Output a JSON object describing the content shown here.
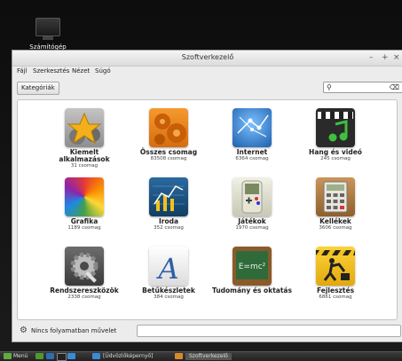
{
  "desktop": {
    "icon_label": "Számítógép"
  },
  "window": {
    "title": "Szoftverkezelő",
    "controls": {
      "minimize": "–",
      "maximize": "+",
      "close": "×"
    }
  },
  "menu": [
    "Fájl",
    "Szerkesztés",
    "Nézet",
    "Súgó"
  ],
  "toolbar": {
    "categories_label": "Kategóriák",
    "search_value": ""
  },
  "categories": [
    {
      "name": "Kiemelt alkalmazások",
      "count": "31 csomag",
      "icon": "star-gears-icon",
      "color": "#9a9a9a"
    },
    {
      "name": "Összes csomag",
      "count": "83508 csomag",
      "icon": "orange-gears-icon",
      "color": "#e8821c"
    },
    {
      "name": "Internet",
      "count": "6364 csomag",
      "icon": "globe-network-icon",
      "color": "#2f7fd6"
    },
    {
      "name": "Hang és videó",
      "count": "245 csomag",
      "icon": "clapper-music-icon",
      "color": "#2a2a2a"
    },
    {
      "name": "Grafika",
      "count": "1189 csomag",
      "icon": "color-wheel-icon",
      "color": "#d93a9a"
    },
    {
      "name": "Iroda",
      "count": "352 csomag",
      "icon": "chart-icon",
      "color": "#1d4f7a"
    },
    {
      "name": "Játékok",
      "count": "1970 csomag",
      "icon": "gamepad-icon",
      "color": "#d8d8c8"
    },
    {
      "name": "Kellékek",
      "count": "3606 csomag",
      "icon": "calculator-icon",
      "color": "#b5834a"
    },
    {
      "name": "Rendszereszközök",
      "count": "2338 csomag",
      "icon": "system-gear-icon",
      "color": "#555555"
    },
    {
      "name": "Betűkészletek",
      "count": "384 csomag",
      "icon": "font-a-icon",
      "color": "#f2f2f2"
    },
    {
      "name": "Tudomány és oktatás",
      "count": "",
      "icon": "chalkboard-icon",
      "color": "#2f6b3a"
    },
    {
      "name": "Fejlesztés",
      "count": "6861 csomag",
      "icon": "construction-icon",
      "color": "#f2c21a"
    }
  ],
  "status": {
    "text": "Nincs folyamatban művelet",
    "field_value": ""
  },
  "panel": {
    "menu_label": "Menü",
    "window1": "[Üdvözlőképernyő]",
    "window2": "Szoftverkezelő"
  }
}
